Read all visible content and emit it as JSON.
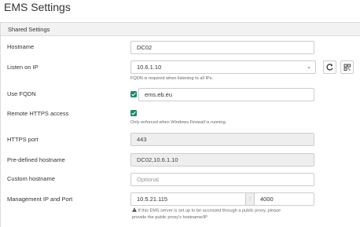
{
  "page": {
    "title": "EMS Settings"
  },
  "panel": {
    "header": "Shared Settings"
  },
  "fields": {
    "hostname": {
      "label": "Hostname",
      "value": "DC02"
    },
    "listen_ip": {
      "label": "Listen on IP",
      "value": "10.6.1.10",
      "help": "FQDN is required when listening to all IPs."
    },
    "use_fqdn": {
      "label": "Use FQDN",
      "checked": true,
      "value": "ems.eb.eu"
    },
    "remote_https": {
      "label": "Remote HTTPS access",
      "checked": true,
      "help": "Only enforced when Windows Firewall is running."
    },
    "https_port": {
      "label": "HTTPS port",
      "value": "443"
    },
    "predefined_hostname": {
      "label": "Pre-defined hostname",
      "value": "DC02,10.6.1.10"
    },
    "custom_hostname": {
      "label": "Custom hostname",
      "placeholder": "Optional"
    },
    "management": {
      "label": "Management IP and Port",
      "ip": "10.5.21.115",
      "separator": ":",
      "port": "4000",
      "warning_line1": "If this EMS server is set up to be accessed through a public proxy, please",
      "warning_line2": "provide the public proxy's hostname/IP"
    }
  },
  "icons": {
    "refresh": "refresh-icon",
    "qr": "qr-code-icon",
    "check": "checkmark-icon",
    "warning": "warning-icon",
    "caret": "chevron-down-icon"
  },
  "colors": {
    "checkbox": "#1a8a6e",
    "readonly_bg": "#eeeeee",
    "border": "#cccccc"
  }
}
